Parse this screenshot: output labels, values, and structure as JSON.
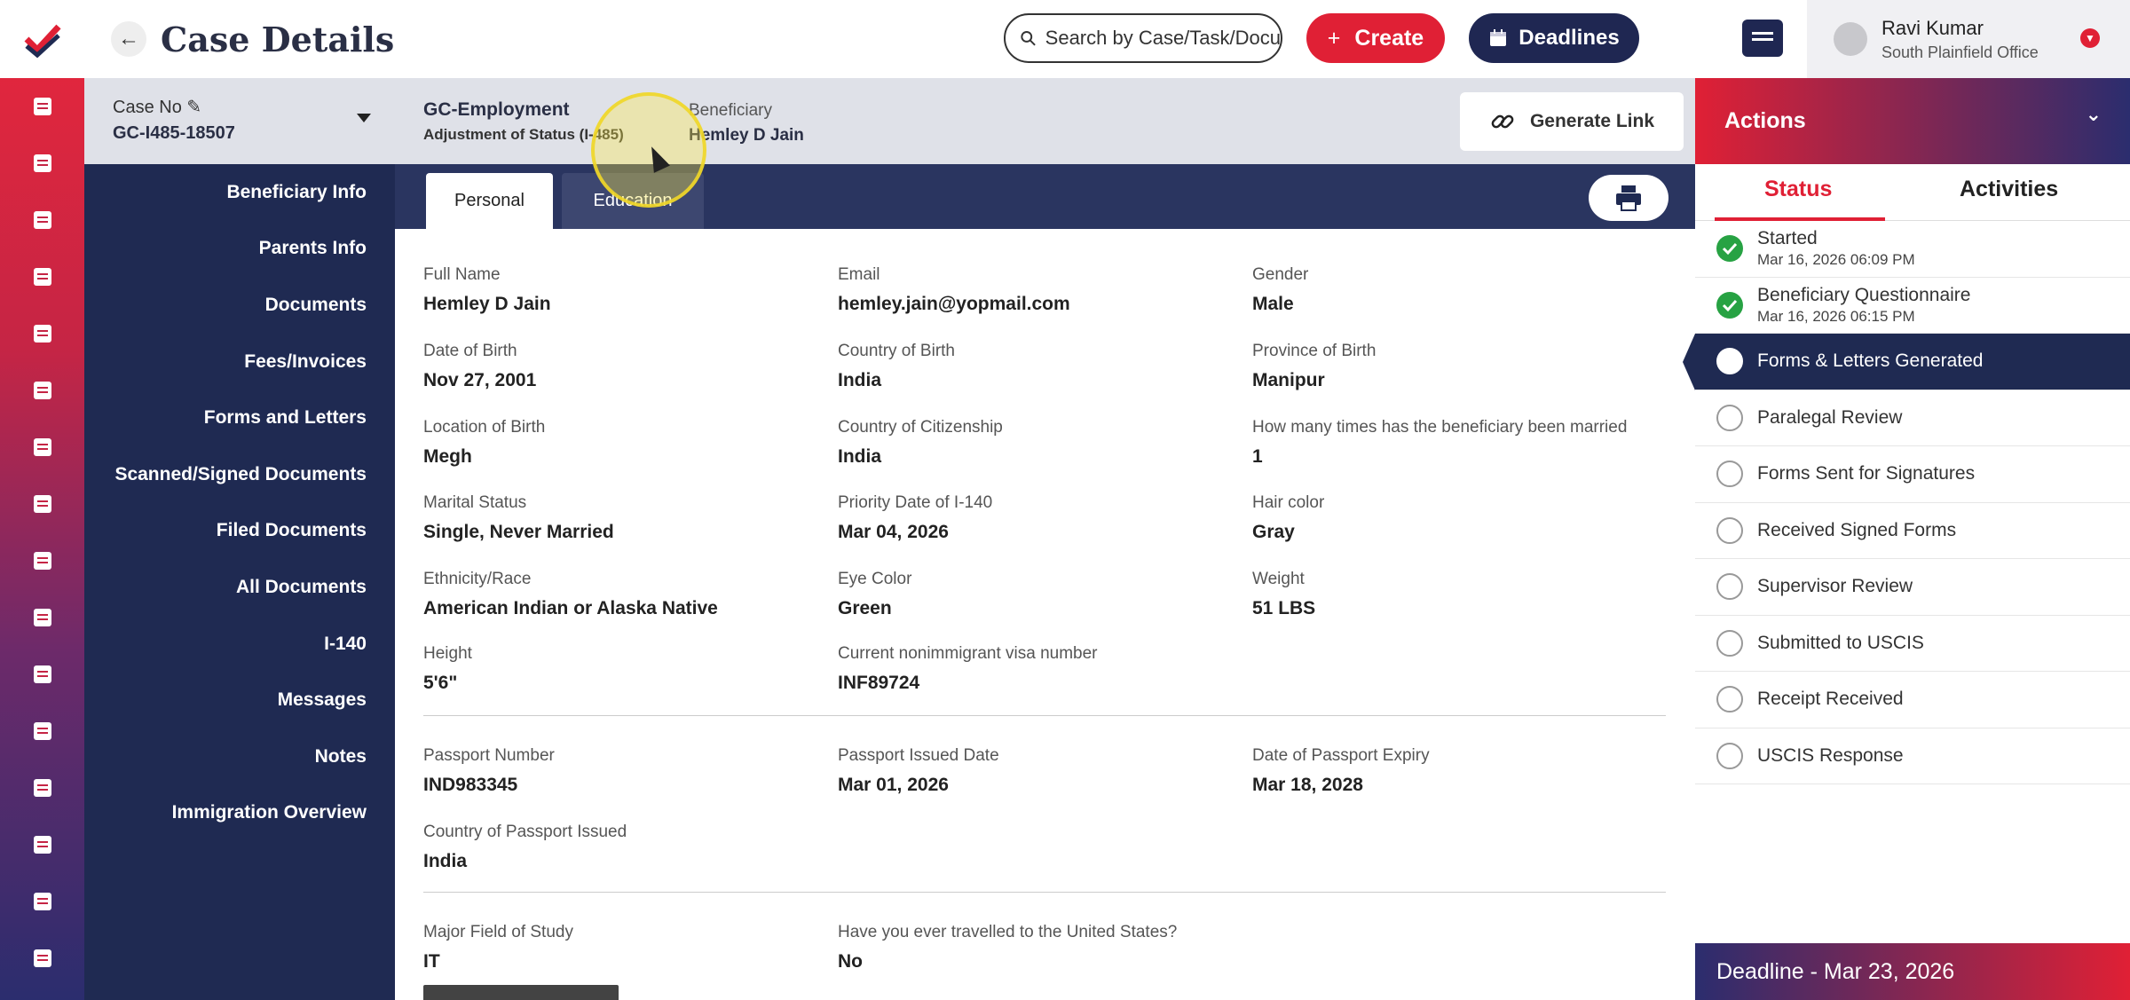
{
  "header": {
    "title": "Case Details",
    "search_placeholder": "Search by Case/Task/Docu",
    "create_label": "Create",
    "deadlines_label": "Deadlines"
  },
  "user": {
    "name": "Ravi Kumar",
    "office": "South Plainfield Office"
  },
  "case": {
    "no_label": "Case No",
    "no_value": "GC-I485-18507",
    "type": "GC-Employment",
    "sub_type": "Adjustment of Status (I-485)",
    "beneficiary_label": "Beneficiary",
    "beneficiary_value": "Hemley D Jain",
    "generate_link": "Generate Link"
  },
  "left_nav": [
    "Beneficiary Info",
    "Parents Info",
    "Documents",
    "Fees/Invoices",
    "Forms and Letters",
    "Scanned/Signed Documents",
    "Filed Documents",
    "All Documents",
    "I-140",
    "Messages",
    "Notes",
    "Immigration Overview"
  ],
  "tabs": {
    "personal": "Personal",
    "education": "Education"
  },
  "fields": [
    {
      "label": "Full Name",
      "value": "Hemley D Jain"
    },
    {
      "label": "Email",
      "value": "hemley.jain@yopmail.com"
    },
    {
      "label": "Gender",
      "value": "Male"
    },
    {
      "label": "Date of Birth",
      "value": "Nov 27, 2001"
    },
    {
      "label": "Country of Birth",
      "value": "India"
    },
    {
      "label": "Province of Birth",
      "value": "Manipur"
    },
    {
      "label": "Location of Birth",
      "value": "Megh"
    },
    {
      "label": "Country of Citizenship",
      "value": "India"
    },
    {
      "label": "How many times has the beneficiary been married",
      "value": "1"
    },
    {
      "label": "Marital Status",
      "value": "Single, Never Married"
    },
    {
      "label": "Priority Date of I-140",
      "value": "Mar 04, 2026"
    },
    {
      "label": "Hair color",
      "value": "Gray"
    },
    {
      "label": "Ethnicity/Race",
      "value": "American Indian or Alaska Native"
    },
    {
      "label": "Eye Color",
      "value": "Green"
    },
    {
      "label": "Weight",
      "value": "51 LBS"
    },
    {
      "label": "Height",
      "value": "5'6\""
    },
    {
      "label": "Current nonimmigrant visa number",
      "value": "INF89724"
    },
    {
      "label": "Passport Number",
      "value": "IND983345"
    },
    {
      "label": "Passport Issued Date",
      "value": "Mar 01, 2026"
    },
    {
      "label": "Date of Passport Expiry",
      "value": "Mar 18, 2028"
    },
    {
      "label": "Country of Passport Issued",
      "value": "India"
    },
    {
      "label": "Major Field of Study",
      "value": "IT"
    },
    {
      "label": "Have you ever travelled to the United States?",
      "value": "No"
    }
  ],
  "actions": {
    "title": "Actions",
    "tab_status": "Status",
    "tab_activities": "Activities",
    "deadline": "Deadline - Mar 23, 2026"
  },
  "statuses": [
    {
      "name": "Started",
      "date": "Mar 16, 2026 06:09 PM",
      "state": "done"
    },
    {
      "name": "Beneficiary Questionnaire",
      "date": "Mar 16, 2026 06:15 PM",
      "state": "done"
    },
    {
      "name": "Forms & Letters Generated",
      "date": "",
      "state": "current"
    },
    {
      "name": "Paralegal Review",
      "date": "",
      "state": "todo"
    },
    {
      "name": "Forms Sent for Signatures",
      "date": "",
      "state": "todo"
    },
    {
      "name": "Received Signed Forms",
      "date": "",
      "state": "todo"
    },
    {
      "name": "Supervisor Review",
      "date": "",
      "state": "todo"
    },
    {
      "name": "Submitted to USCIS",
      "date": "",
      "state": "todo"
    },
    {
      "name": "Receipt Received",
      "date": "",
      "state": "todo"
    },
    {
      "name": "USCIS Response",
      "date": "",
      "state": "todo"
    }
  ],
  "colors": {
    "accent": "#e02035",
    "navy": "#1f2a52",
    "done": "#27a243"
  },
  "icons": {
    "rail": [
      "dashboard-icon",
      "cases-icon",
      "tasks-icon",
      "calendar-icon",
      "forms-icon",
      "messages-icon",
      "documents-icon",
      "edit-icon",
      "reports-icon",
      "clipboard-icon",
      "user-icon",
      "contacts-icon",
      "folder-icon",
      "notes-icon",
      "admin-icon",
      "book-icon"
    ]
  }
}
